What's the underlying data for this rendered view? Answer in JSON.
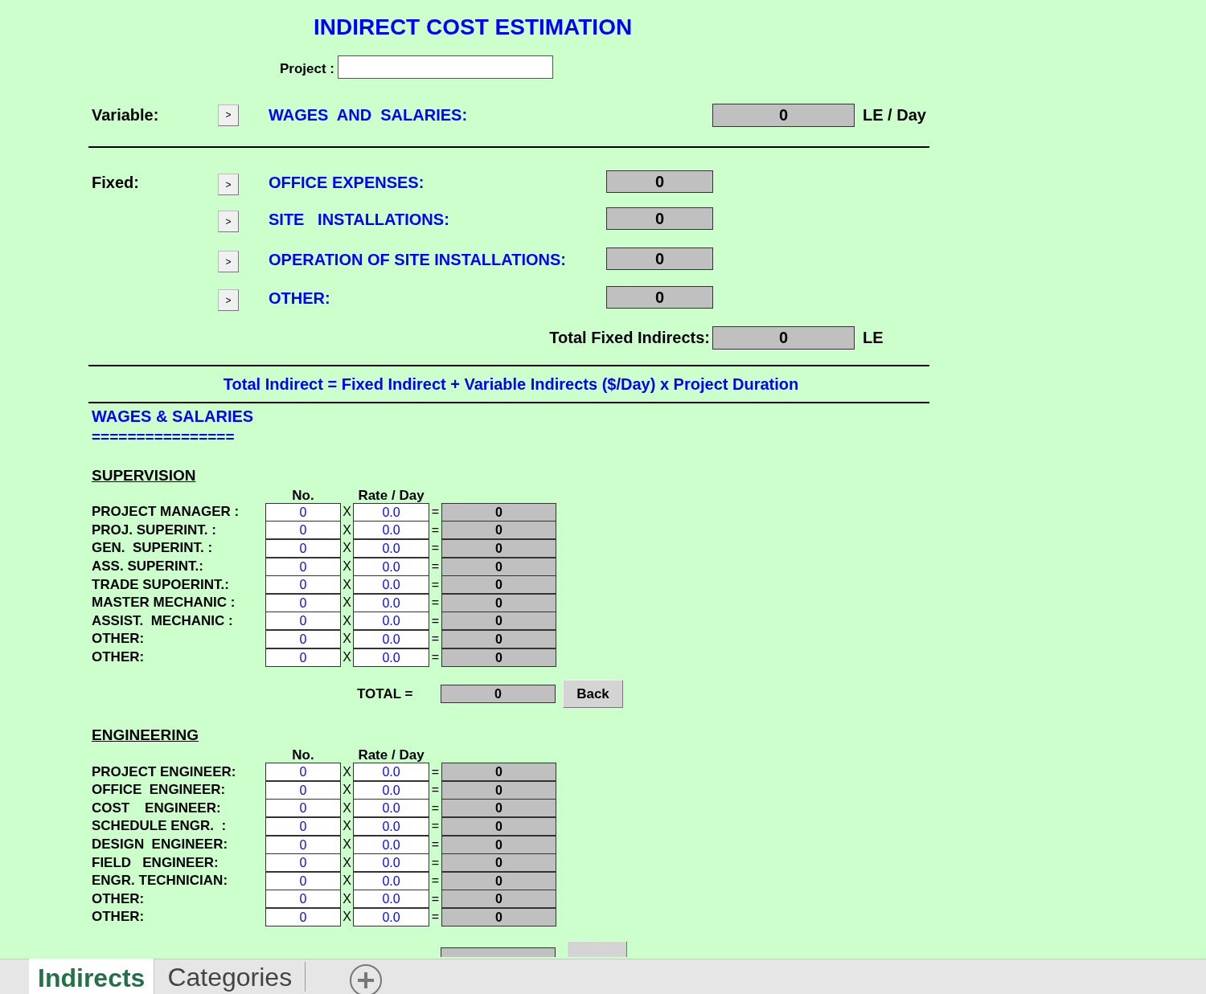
{
  "title": "INDIRECT COST ESTIMATION",
  "project": {
    "label": "Project :"
  },
  "variable": {
    "label": "Variable:",
    "items": [
      {
        "button": ">",
        "name": "WAGES  AND  SALARIES:",
        "value": "0",
        "unit": "LE / Day"
      }
    ]
  },
  "fixed": {
    "label": "Fixed:",
    "items": [
      {
        "button": ">",
        "name": "OFFICE EXPENSES:",
        "value": "0"
      },
      {
        "button": ">",
        "name": "SITE   INSTALLATIONS:",
        "value": "0"
      },
      {
        "button": ">",
        "name": "OPERATION OF SITE INSTALLATIONS:",
        "value": "0"
      },
      {
        "button": ">",
        "name": "OTHER:",
        "value": "0"
      }
    ]
  },
  "total_fixed": {
    "label": "Total Fixed Indirects:",
    "value": "0",
    "unit": "LE"
  },
  "formula": "Total Indirect = Fixed Indirect + Variable Indirects ($/Day) x Project Duration",
  "section_title": "WAGES & SALARIES",
  "section_rule": "================",
  "groups": [
    {
      "title": "SUPERVISION",
      "col_no": "No.",
      "col_rate": "Rate / Day",
      "cut": false,
      "total_label": "TOTAL =",
      "total": "0",
      "back": "Back",
      "rows": [
        {
          "label": "PROJECT MANAGER :",
          "no": "0",
          "times": "X",
          "rate": "0.0",
          "equals": "=",
          "result": "0"
        },
        {
          "label": "PROJ. SUPERINT. :",
          "no": "0",
          "times": "X",
          "rate": "0.0",
          "equals": "=",
          "result": "0"
        },
        {
          "label": "GEN.  SUPERINT. :",
          "no": "0",
          "times": "X",
          "rate": "0.0",
          "equals": "=",
          "result": "0"
        },
        {
          "label": "ASS. SUPERINT.:",
          "no": "0",
          "times": "X",
          "rate": "0.0",
          "equals": "=",
          "result": "0"
        },
        {
          "label": "TRADE SUPOERINT.:",
          "no": "0",
          "times": "X",
          "rate": "0.0",
          "equals": "=",
          "result": "0"
        },
        {
          "label": "MASTER MECHANIC :",
          "no": "0",
          "times": "X",
          "rate": "0.0",
          "equals": "=",
          "result": "0"
        },
        {
          "label": "ASSIST.  MECHANIC :",
          "no": "0",
          "times": "X",
          "rate": "0.0",
          "equals": "=",
          "result": "0"
        },
        {
          "label": "OTHER:",
          "no": "0",
          "times": "X",
          "rate": "0.0",
          "equals": "=",
          "result": "0"
        },
        {
          "label": "OTHER:",
          "no": "0",
          "times": "X",
          "rate": "0.0",
          "equals": "=",
          "result": "0"
        }
      ]
    },
    {
      "title": "ENGINEERING",
      "col_no": "No.",
      "col_rate": "Rate / Day",
      "cut": true,
      "rows": [
        {
          "label": "PROJECT ENGINEER:",
          "no": "0",
          "times": "X",
          "rate": "0.0",
          "equals": "=",
          "result": "0"
        },
        {
          "label": "OFFICE  ENGINEER:",
          "no": "0",
          "times": "X",
          "rate": "0.0",
          "equals": "=",
          "result": "0"
        },
        {
          "label": "COST    ENGINEER:",
          "no": "0",
          "times": "X",
          "rate": "0.0",
          "equals": "=",
          "result": "0"
        },
        {
          "label": "SCHEDULE ENGR.  :",
          "no": "0",
          "times": "X",
          "rate": "0.0",
          "equals": "=",
          "result": "0"
        },
        {
          "label": "DESIGN  ENGINEER:",
          "no": "0",
          "times": "X",
          "rate": "0.0",
          "equals": "=",
          "result": "0"
        },
        {
          "label": "FIELD   ENGINEER:",
          "no": "0",
          "times": "X",
          "rate": "0.0",
          "equals": "=",
          "result": "0"
        },
        {
          "label": "ENGR. TECHNICIAN:",
          "no": "0",
          "times": "X",
          "rate": "0.0",
          "equals": "=",
          "result": "0"
        },
        {
          "label": "OTHER:",
          "no": "0",
          "times": "X",
          "rate": "0.0",
          "equals": "=",
          "result": "0"
        },
        {
          "label": "OTHER:",
          "no": "0",
          "times": "X",
          "rate": "0.0",
          "equals": "=",
          "result": "0"
        }
      ]
    }
  ],
  "sheet_tabs": [
    {
      "label": "Indirects",
      "selected": true
    },
    {
      "label": "Categories",
      "selected": false
    }
  ]
}
